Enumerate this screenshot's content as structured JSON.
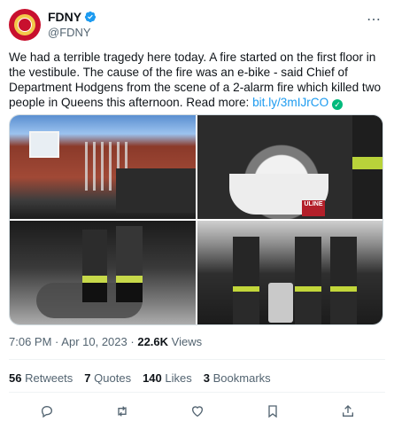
{
  "author": {
    "name": "FDNY",
    "handle": "@FDNY",
    "verified": true,
    "avatar_color": "#c8102e"
  },
  "tweet": {
    "text_main": "We had a terrible tragedy here today. A fire started on the first floor in the vestibule. The cause of the fire was an e-bike - said Chief of Department Hodgens from the scene of a 2-alarm fire which killed two people in Queens this afternoon. Read more:",
    "link": "bit.ly/3mIJrCO"
  },
  "media": {
    "photos": [
      "firefighters-outside-brick-house",
      "burned-battery-in-bucket",
      "firefighter-boots-near-e-bike",
      "firefighters-with-bucket-on-street"
    ],
    "bucket_label": "ULINE"
  },
  "meta": {
    "time": "7:06 PM",
    "separator": "·",
    "date": "Apr 10, 2023",
    "views_count": "22.6K",
    "views_label": "Views"
  },
  "stats": {
    "retweets_count": "56",
    "retweets_label": "Retweets",
    "quotes_count": "7",
    "quotes_label": "Quotes",
    "likes_count": "140",
    "likes_label": "Likes",
    "bookmarks_count": "3",
    "bookmarks_label": "Bookmarks"
  },
  "actions": [
    "reply-icon",
    "retweet-icon",
    "like-icon",
    "bookmark-icon",
    "share-icon"
  ],
  "colors": {
    "link": "#1d9bf0",
    "verified": "#1d9bf0",
    "muted": "#536471",
    "text": "#0f1419"
  }
}
